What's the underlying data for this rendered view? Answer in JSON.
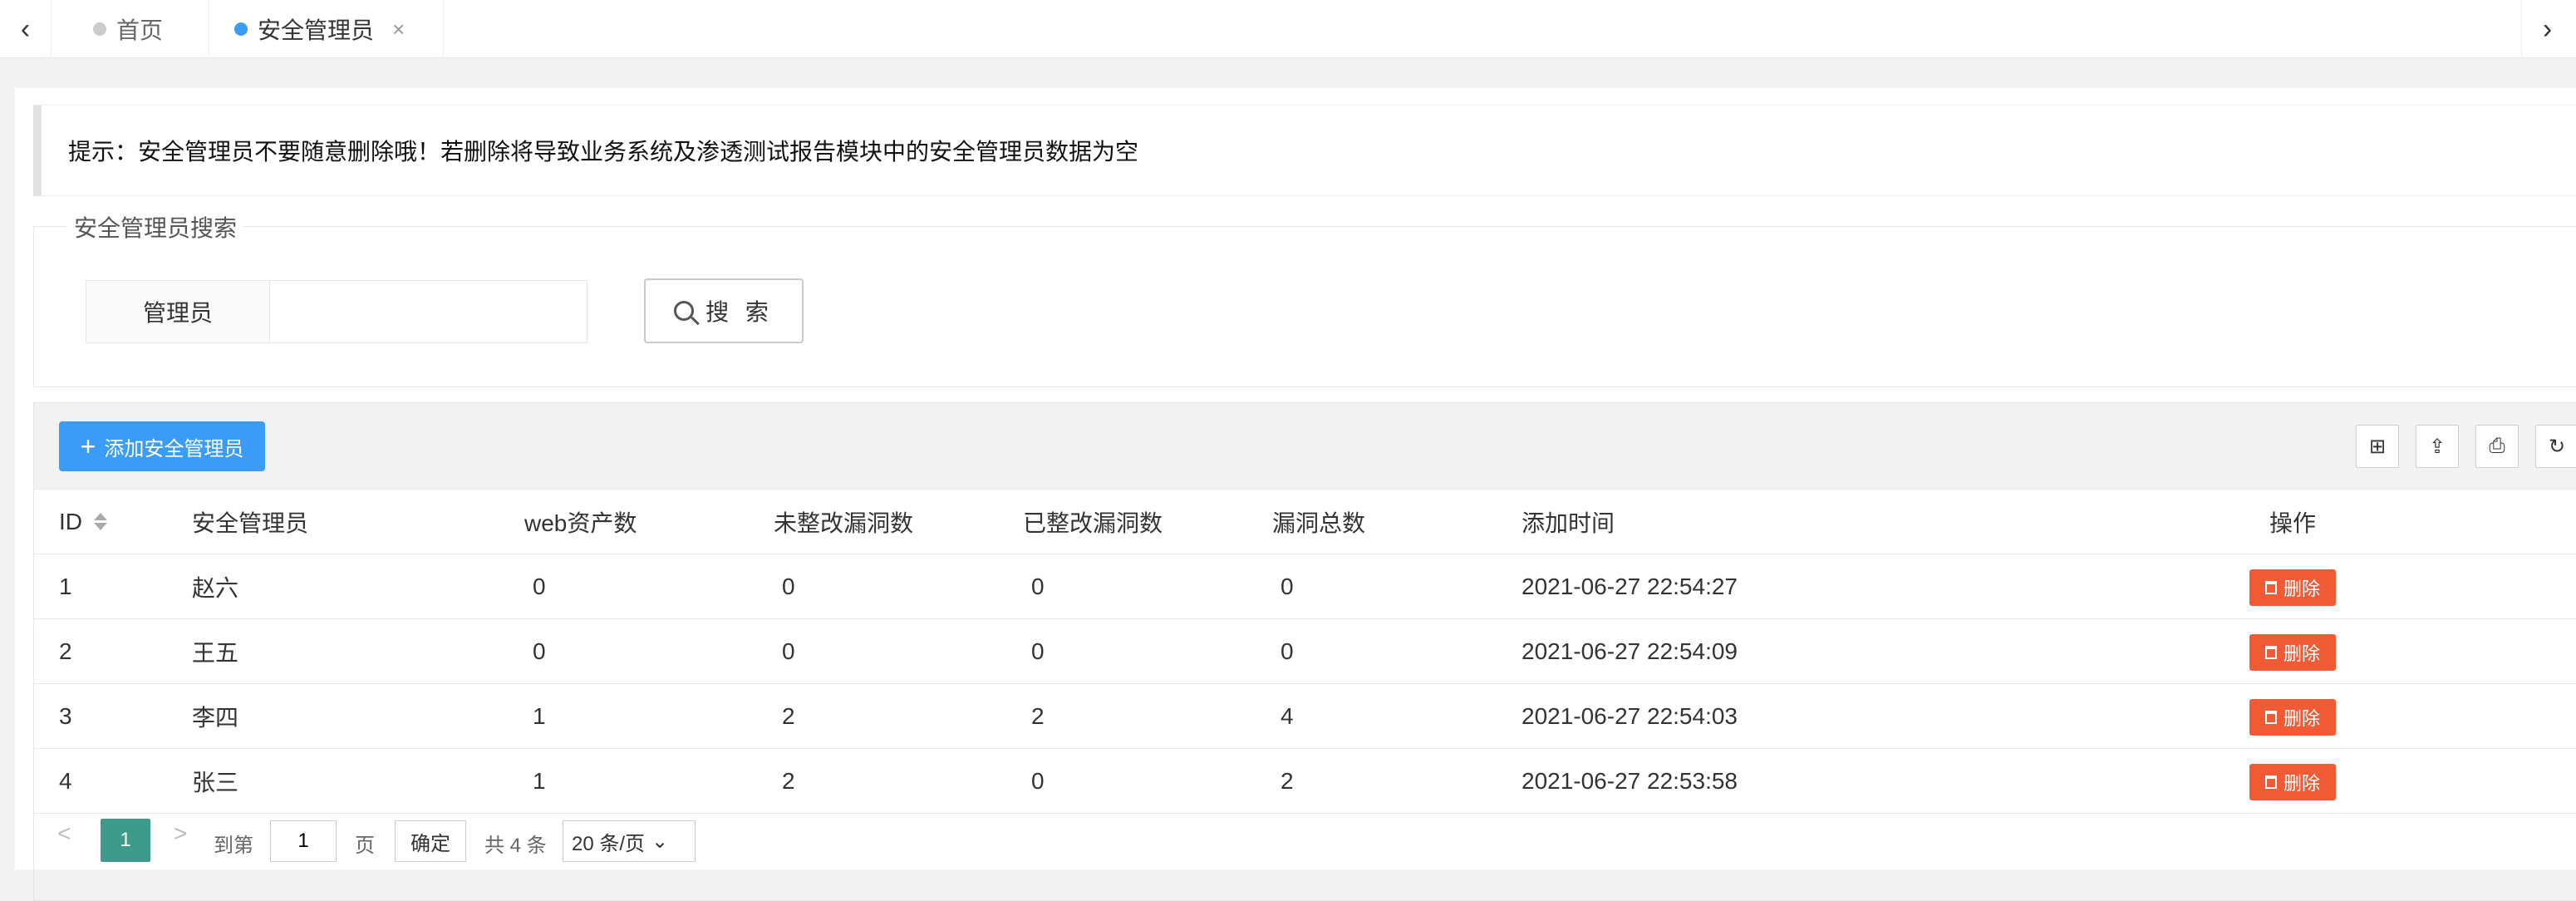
{
  "tabs": [
    {
      "label": "首页",
      "active": false
    },
    {
      "label": "安全管理员",
      "active": true,
      "close": "×"
    }
  ],
  "nav": {
    "left_icon": "chevron-left-icon",
    "right_icon": "chevron-right-icon",
    "left_glyph": "‹",
    "right_glyph": "›"
  },
  "notice": "提示：安全管理员不要随意删除哦！若删除将导致业务系统及渗透测试报告模块中的安全管理员数据为空",
  "search": {
    "legend": "安全管理员搜索",
    "label": "管理员",
    "value": "",
    "button_label": "搜 索"
  },
  "toolbar": {
    "add_label": "添加安全管理员",
    "icons": [
      "columns-icon",
      "export-icon",
      "print-icon",
      "refresh-icon"
    ],
    "icon_glyphs": [
      "⊞",
      "⇪",
      "⎙",
      "↻"
    ]
  },
  "table": {
    "columns": [
      "ID",
      "安全管理员",
      "web资产数",
      "未整改漏洞数",
      "已整改漏洞数",
      "漏洞总数",
      "添加时间",
      "操作"
    ],
    "rows": [
      {
        "id": "1",
        "name": "赵六",
        "web": "0",
        "unfixed": "0",
        "fixed": "0",
        "total": "0",
        "time": "2021-06-27 22:54:27",
        "action": "删除"
      },
      {
        "id": "2",
        "name": "王五",
        "web": "0",
        "unfixed": "0",
        "fixed": "0",
        "total": "0",
        "time": "2021-06-27 22:54:09",
        "action": "删除"
      },
      {
        "id": "3",
        "name": "李四",
        "web": "1",
        "unfixed": "2",
        "fixed": "2",
        "total": "4",
        "time": "2021-06-27 22:54:03",
        "action": "删除"
      },
      {
        "id": "4",
        "name": "张三",
        "web": "1",
        "unfixed": "2",
        "fixed": "0",
        "total": "2",
        "time": "2021-06-27 22:53:58",
        "action": "删除"
      }
    ]
  },
  "pager": {
    "prev": "<",
    "current": "1",
    "next": ">",
    "goto_label": "到第",
    "goto_value": "1",
    "page_unit": "页",
    "confirm": "确定",
    "total": "共 4 条",
    "page_size": "20 条/页"
  },
  "colors": {
    "accent": "#3a9cf7",
    "danger": "#f05a35",
    "pager_active": "#3e9a8a"
  }
}
